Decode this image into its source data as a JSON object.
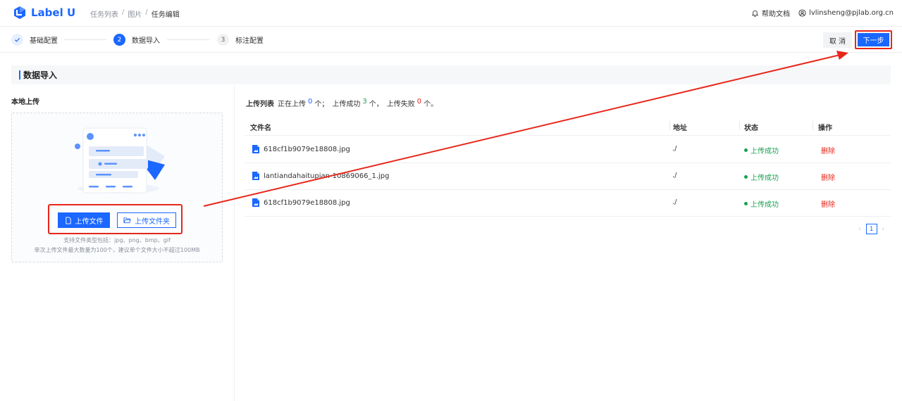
{
  "app": {
    "logo_text": "Label U"
  },
  "breadcrumb": {
    "items": [
      "任务列表",
      "图片"
    ],
    "current": "任务编辑",
    "separator": "/"
  },
  "header_right": {
    "help": "帮助文档",
    "user": "lvlinsheng@pjlab.org.cn"
  },
  "steps": [
    {
      "index": "1",
      "label": "基础配置",
      "state": "done"
    },
    {
      "index": "2",
      "label": "数据导入",
      "state": "active"
    },
    {
      "index": "3",
      "label": "标注配置",
      "state": "idle"
    }
  ],
  "actions": {
    "cancel": "取 消",
    "next": "下一步"
  },
  "section": {
    "title": "数据导入"
  },
  "upload": {
    "title": "本地上传",
    "upload_file": "上传文件",
    "upload_folder": "上传文件夹",
    "hint1": "支持文件类型包括：jpg、png、bmp、gif",
    "hint2": "单次上传文件最大数量为100个，建议单个文件大小不超过100MB"
  },
  "list": {
    "label": "上传列表",
    "uploading_prefix": "正在上传",
    "uploading_count": "0",
    "uploading_suffix": "个；",
    "success_prefix": "上传成功",
    "success_count": "3",
    "success_suffix": "个，",
    "fail_prefix": "上传失败",
    "fail_count": "0",
    "fail_suffix": "个。"
  },
  "table": {
    "columns": [
      "文件名",
      "地址",
      "状态",
      "操作"
    ],
    "rows": [
      {
        "name": "618cf1b9079e18808.jpg",
        "address": "./",
        "status": "上传成功",
        "action": "删除"
      },
      {
        "name": "lantiandahaitupian-10869066_1.jpg",
        "address": "./",
        "status": "上传成功",
        "action": "删除"
      },
      {
        "name": "618cf1b9079e18808.jpg",
        "address": "./",
        "status": "上传成功",
        "action": "删除"
      }
    ]
  },
  "pagination": {
    "current": "1",
    "prev": "‹",
    "next": "›"
  },
  "colors": {
    "primary": "#1b67ff",
    "success": "#1aa052",
    "danger": "#e8261a",
    "annotation": "#e8261a"
  }
}
